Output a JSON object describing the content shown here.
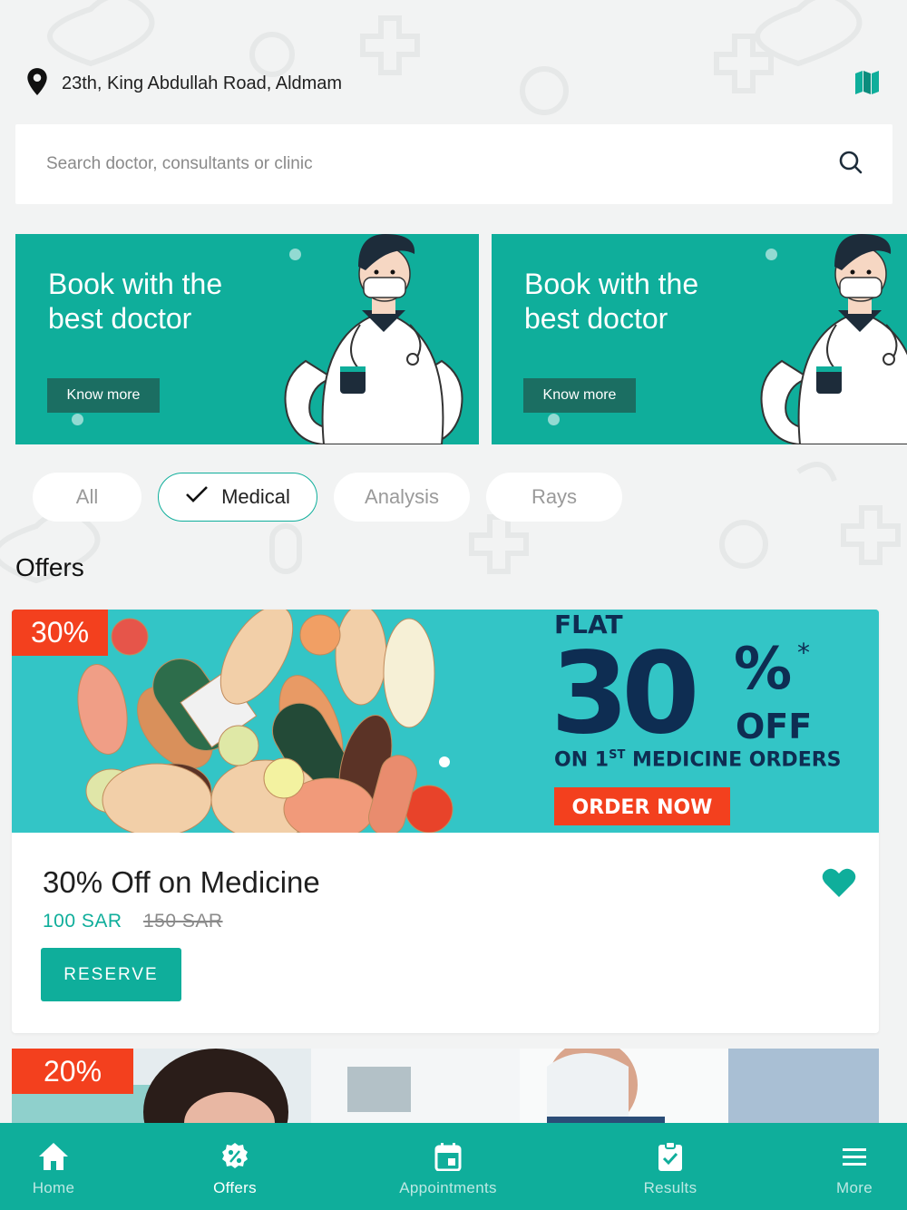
{
  "location": {
    "address": "23th, King Abdullah Road, Aldmam"
  },
  "search": {
    "placeholder": "Search doctor, consultants or clinic"
  },
  "banners": [
    {
      "title": "Book with the best doctor",
      "button": "Know more"
    },
    {
      "title": "Book with the best doctor",
      "button": "Know more"
    }
  ],
  "filters": [
    {
      "label": "All",
      "selected": false
    },
    {
      "label": "Medical",
      "selected": true
    },
    {
      "label": "Analysis",
      "selected": false
    },
    {
      "label": "Rays",
      "selected": false
    }
  ],
  "offers": {
    "title": "Offers",
    "items": [
      {
        "badge": "30%",
        "name": "30% Off on Medicine",
        "price": "100 SAR",
        "old_price": "150 SAR",
        "button": "RESERVE",
        "favorite": true,
        "promo": {
          "flat": "FLAT",
          "big": "30",
          "percent": "%",
          "star": "*",
          "off": "OFF",
          "on": "ON 1",
          "sup": "ST",
          "orders": " MEDICINE ORDERS",
          "cta": "ORDER NOW"
        }
      },
      {
        "badge": "20%"
      }
    ]
  },
  "nav": [
    {
      "label": "Home",
      "icon": "home-icon",
      "active": false
    },
    {
      "label": "Offers",
      "icon": "percent-badge-icon",
      "active": true
    },
    {
      "label": "Appointments",
      "icon": "calendar-icon",
      "active": false
    },
    {
      "label": "Results",
      "icon": "clipboard-check-icon",
      "active": false
    },
    {
      "label": "More",
      "icon": "menu-icon",
      "active": false
    }
  ],
  "colors": {
    "primary": "#0fae9b",
    "badge": "#f3401e",
    "background": "#f2f3f3"
  }
}
